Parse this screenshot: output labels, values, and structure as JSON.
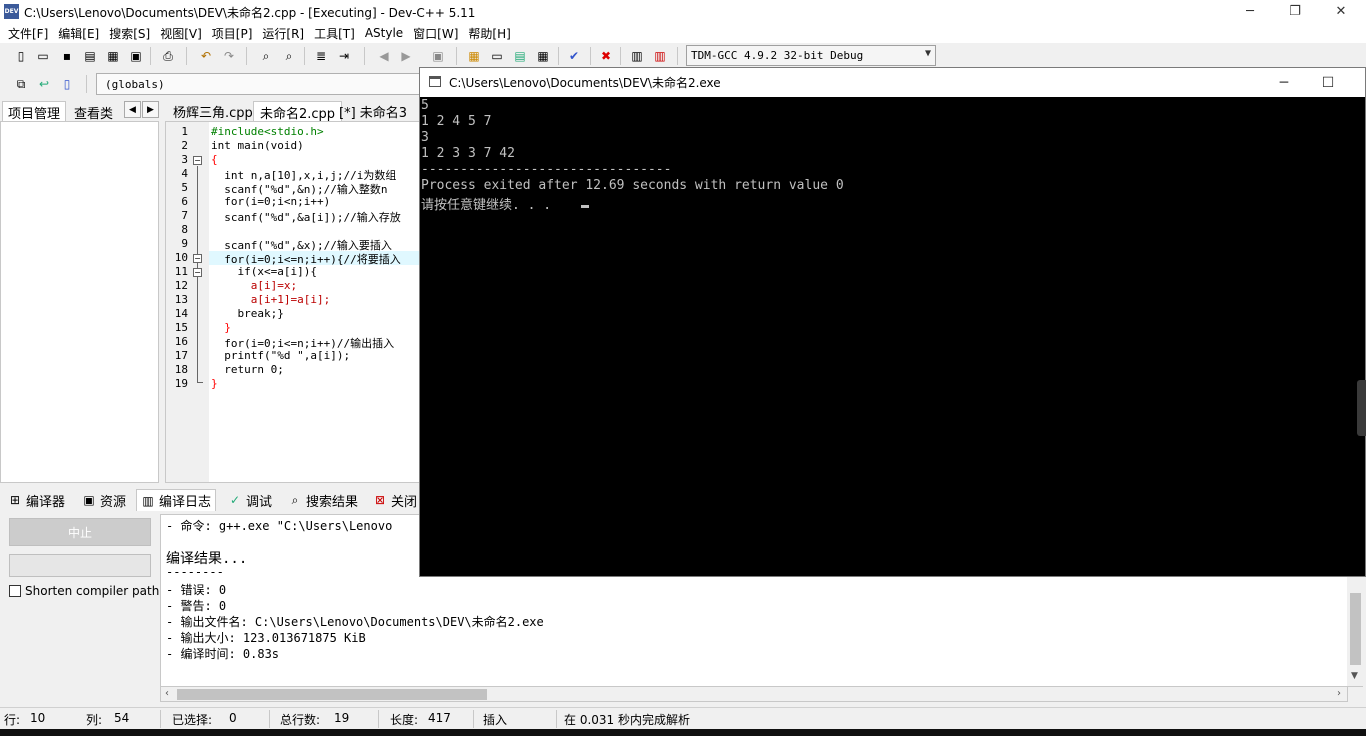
{
  "window": {
    "title": "C:\\Users\\Lenovo\\Documents\\DEV\\未命名2.cpp - [Executing] - Dev-C++ 5.11",
    "icon_label": "DEV"
  },
  "menu": [
    "文件[F]",
    "编辑[E]",
    "搜索[S]",
    "视图[V]",
    "项目[P]",
    "运行[R]",
    "工具[T]",
    "AStyle",
    "窗口[W]",
    "帮助[H]"
  ],
  "toolbar": {
    "compiler": "TDM-GCC 4.9.2 32-bit Debug",
    "scope": "(globals)"
  },
  "left_tabs": [
    "项目管理",
    "查看类"
  ],
  "editor_tabs": [
    "杨辉三角.cpp",
    "未命名2.cpp",
    "[*] 未命名3"
  ],
  "editor": {
    "line_numbers": [
      "1",
      "2",
      "3",
      "4",
      "5",
      "6",
      "7",
      "8",
      "9",
      "10",
      "11",
      "12",
      "13",
      "14",
      "15",
      "16",
      "17",
      "18",
      "19"
    ],
    "lines": [
      "#include<stdio.h>",
      "int main(void)",
      "{",
      "  int n,a[10],x,i,j;//i为数组",
      "  scanf(\"%d\",&n);//输入整数n",
      "  for(i=0;i<n;i++)",
      "  scanf(\"%d\",&a[i]);//输入存放",
      "",
      "  scanf(\"%d\",&x);//输入要插入",
      "  for(i=0;i<=n;i++){//将要插入",
      "    if(x<=a[i]){",
      "      a[i]=x;",
      "      a[i+1]=a[i];",
      "    break;}",
      "  }",
      "  for(i=0;i<=n;i++)//输出插入",
      "  printf(\"%d \",a[i]);",
      "  return 0;",
      "}"
    ]
  },
  "bottom_tabs": [
    "编译器",
    "资源",
    "编译日志",
    "调试",
    "搜索结果",
    "关闭"
  ],
  "bottom_left": {
    "stop_label": "中止",
    "shorten_label": "Shorten compiler paths"
  },
  "log": [
    "- 命令: g++.exe \"C:\\Users\\Lenovo",
    "",
    "编译结果...",
    "--------",
    "- 错误: 0",
    "- 警告: 0",
    "- 输出文件名: C:\\Users\\Lenovo\\Documents\\DEV\\未命名2.exe",
    "- 输出大小: 123.013671875 KiB",
    "- 编译时间: 0.83s"
  ],
  "status": {
    "row_label": "行:",
    "row_value": "10",
    "col_label": "列:",
    "col_value": "54",
    "sel_label": "已选择:",
    "sel_value": "0",
    "total_label": "总行数:",
    "total_value": "19",
    "len_label": "长度:",
    "len_value": "417",
    "mode": "插入",
    "parse": "在 0.031 秒内完成解析"
  },
  "console": {
    "title": "C:\\Users\\Lenovo\\Documents\\DEV\\未命名2.exe",
    "lines": [
      "5",
      "1 2 4 5 7",
      "3",
      "1 2 3 3 7 42",
      "--------------------------------",
      "Process exited after 12.69 seconds with return value 0",
      "请按任意键继续. . ."
    ]
  }
}
